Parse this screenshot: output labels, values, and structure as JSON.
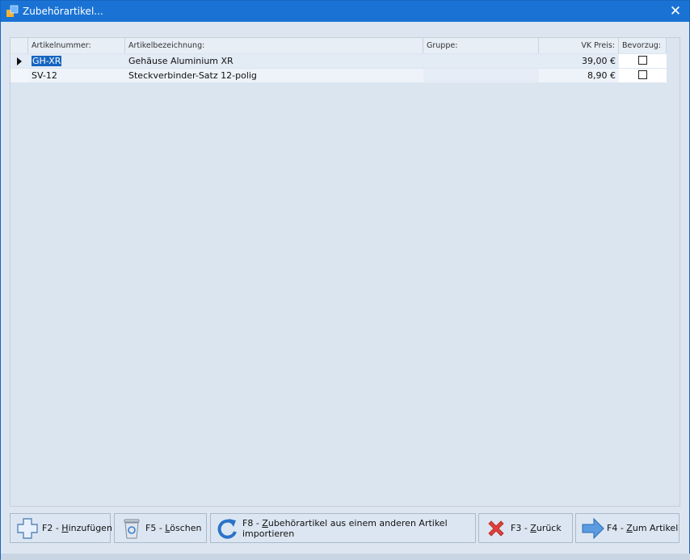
{
  "window": {
    "title": "Zubehörartikel...",
    "close_symbol": "✕"
  },
  "table": {
    "columns": [
      "Artikelnummer:",
      "Artikelbezeichnung:",
      "Gruppe:",
      "VK Preis:",
      "Bevorzug:"
    ],
    "rows": [
      {
        "artikelnummer": "GH-XR",
        "bezeichnung": "Gehäuse Aluminium XR",
        "gruppe": "",
        "preis": "39,00 €",
        "bevorzugt": false,
        "selected": true
      },
      {
        "artikelnummer": "SV-12",
        "bezeichnung": "Steckverbinder-Satz 12-polig",
        "gruppe": "",
        "preis": "8,90 €",
        "bevorzugt": false,
        "selected": false
      }
    ]
  },
  "buttons": {
    "add": {
      "key": "F2 - ",
      "hotkey": "H",
      "rest": "inzufügen",
      "icon": "plus-icon"
    },
    "delete": {
      "key": "F5 - ",
      "hotkey": "L",
      "rest": "öschen",
      "icon": "trash-icon"
    },
    "import": {
      "key": "F8 - ",
      "hotkey": "Z",
      "rest": "ubehörartikel aus einem anderen Artikel importieren",
      "icon": "rotate-arrow-icon"
    },
    "back": {
      "key": "F3 - ",
      "hotkey": "Z",
      "rest": "urück",
      "icon": "red-x-icon"
    },
    "to_article": {
      "key": "F4 - ",
      "hotkey": "Z",
      "rest": "um Artikel",
      "icon": "right-arrow-icon"
    }
  },
  "colors": {
    "titlebar": "#1a73d4",
    "selection": "#1565c0",
    "background": "#dde6f0"
  }
}
